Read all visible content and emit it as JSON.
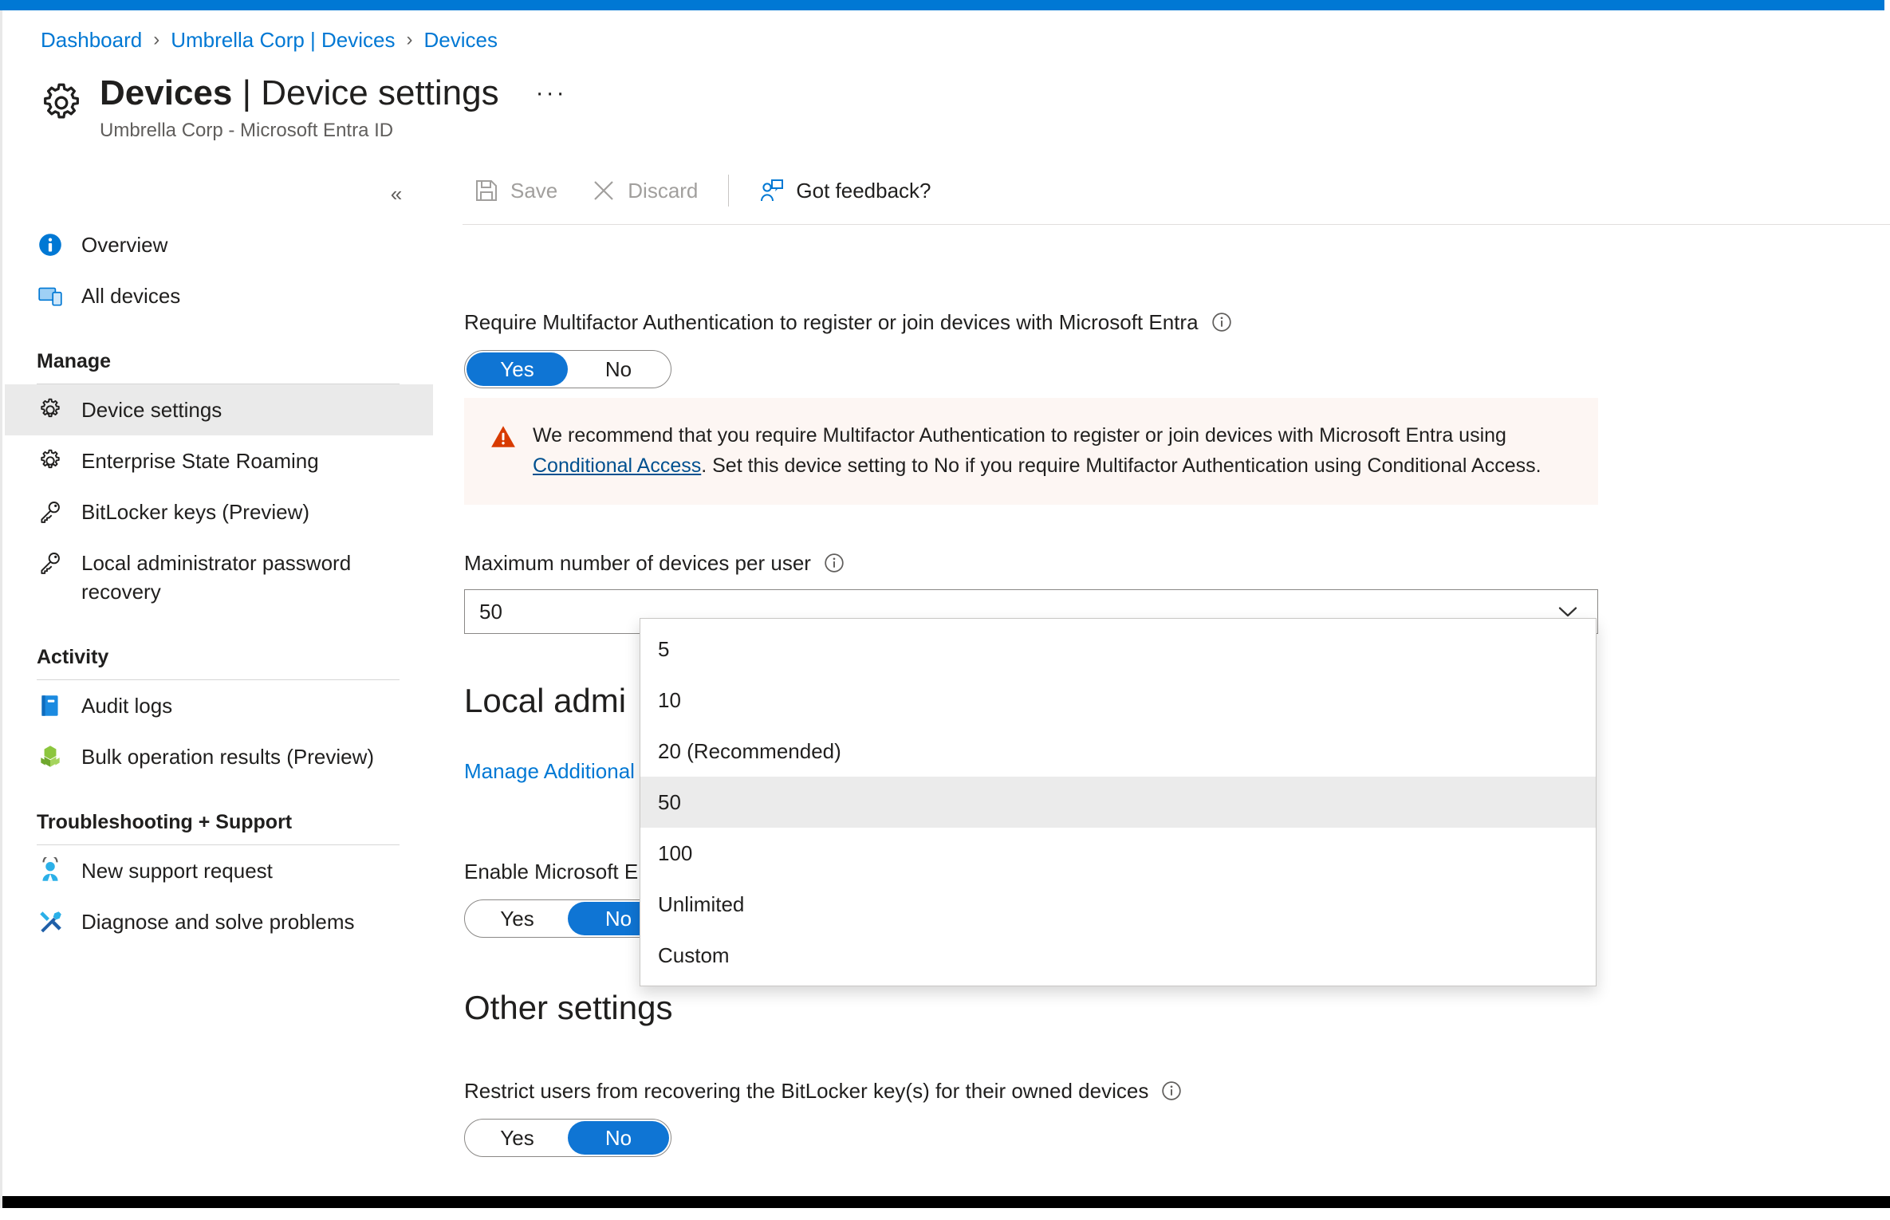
{
  "theme": {
    "accent": "#0078d4",
    "toggle_on": "#0f75d4",
    "link": "#0078d4",
    "warning_bg": "#fdf6f3",
    "warning_icon": "#d83b01",
    "selected_nav_bg": "#eaeaea"
  },
  "breadcrumb": {
    "items": [
      {
        "label": "Dashboard"
      },
      {
        "label": "Umbrella Corp | Devices"
      },
      {
        "label": "Devices"
      }
    ],
    "separator": "›"
  },
  "header": {
    "icon": "gear-icon",
    "title_bold": "Devices",
    "title_separator": " | ",
    "title_rest": "Device settings",
    "subtitle": "Umbrella Corp - Microsoft Entra ID",
    "more_menu": "···"
  },
  "sidebar": {
    "collapse_glyph": "«",
    "top_items": [
      {
        "label": "Overview",
        "icon": "info-circle-icon",
        "selected": false
      },
      {
        "label": "All devices",
        "icon": "devices-icon",
        "selected": false
      }
    ],
    "groups": [
      {
        "title": "Manage",
        "items": [
          {
            "label": "Device settings",
            "icon": "gear-icon",
            "selected": true
          },
          {
            "label": "Enterprise State Roaming",
            "icon": "gear-icon",
            "selected": false
          },
          {
            "label": "BitLocker keys (Preview)",
            "icon": "key-icon",
            "selected": false
          },
          {
            "label": "Local administrator password recovery",
            "icon": "key-icon",
            "selected": false
          }
        ]
      },
      {
        "title": "Activity",
        "items": [
          {
            "label": "Audit logs",
            "icon": "book-icon",
            "selected": false
          },
          {
            "label": "Bulk operation results (Preview)",
            "icon": "cubes-icon",
            "selected": false
          }
        ]
      },
      {
        "title": "Troubleshooting + Support",
        "items": [
          {
            "label": "New support request",
            "icon": "person-support-icon",
            "selected": false
          },
          {
            "label": "Diagnose and solve problems",
            "icon": "wrench-screwdriver-icon",
            "selected": false
          }
        ]
      }
    ]
  },
  "command_bar": {
    "save": {
      "label": "Save",
      "icon": "save-disk-icon",
      "enabled": false
    },
    "discard": {
      "label": "Discard",
      "icon": "close-x-icon",
      "enabled": false
    },
    "feedback": {
      "label": "Got feedback?",
      "icon": "feedback-person-icon",
      "enabled": true
    }
  },
  "settings": {
    "mfa": {
      "label": "Require Multifactor Authentication to register or join devices with Microsoft Entra",
      "info": "info-icon",
      "yes_label": "Yes",
      "no_label": "No",
      "value": "Yes"
    },
    "warning": {
      "icon": "warning-triangle-icon",
      "text_before": "We recommend that you require Multifactor Authentication to register or join devices with Microsoft Entra using ",
      "link_text": "Conditional Access",
      "text_after": ". Set this device setting to No if you require Multifactor Authentication using Conditional Access."
    },
    "max_devices": {
      "label": "Maximum number of devices per user",
      "info": "info-icon",
      "value": "50",
      "chevron": "chevron-down-icon",
      "options": [
        "5",
        "10",
        "20 (Recommended)",
        "50",
        "100",
        "Unlimited",
        "Custom"
      ],
      "selected_option": "50",
      "open": true
    },
    "local_admin": {
      "heading": "Local admi",
      "manage_link": "Manage Additional",
      "enable_label": "Enable Microsoft En",
      "yes_label": "Yes",
      "no_label": "No",
      "value": "No"
    },
    "other": {
      "heading": "Other settings",
      "bitlocker": {
        "label": "Restrict users from recovering the BitLocker key(s) for their owned devices",
        "info": "info-icon",
        "yes_label": "Yes",
        "no_label": "No",
        "value": "No"
      }
    }
  }
}
